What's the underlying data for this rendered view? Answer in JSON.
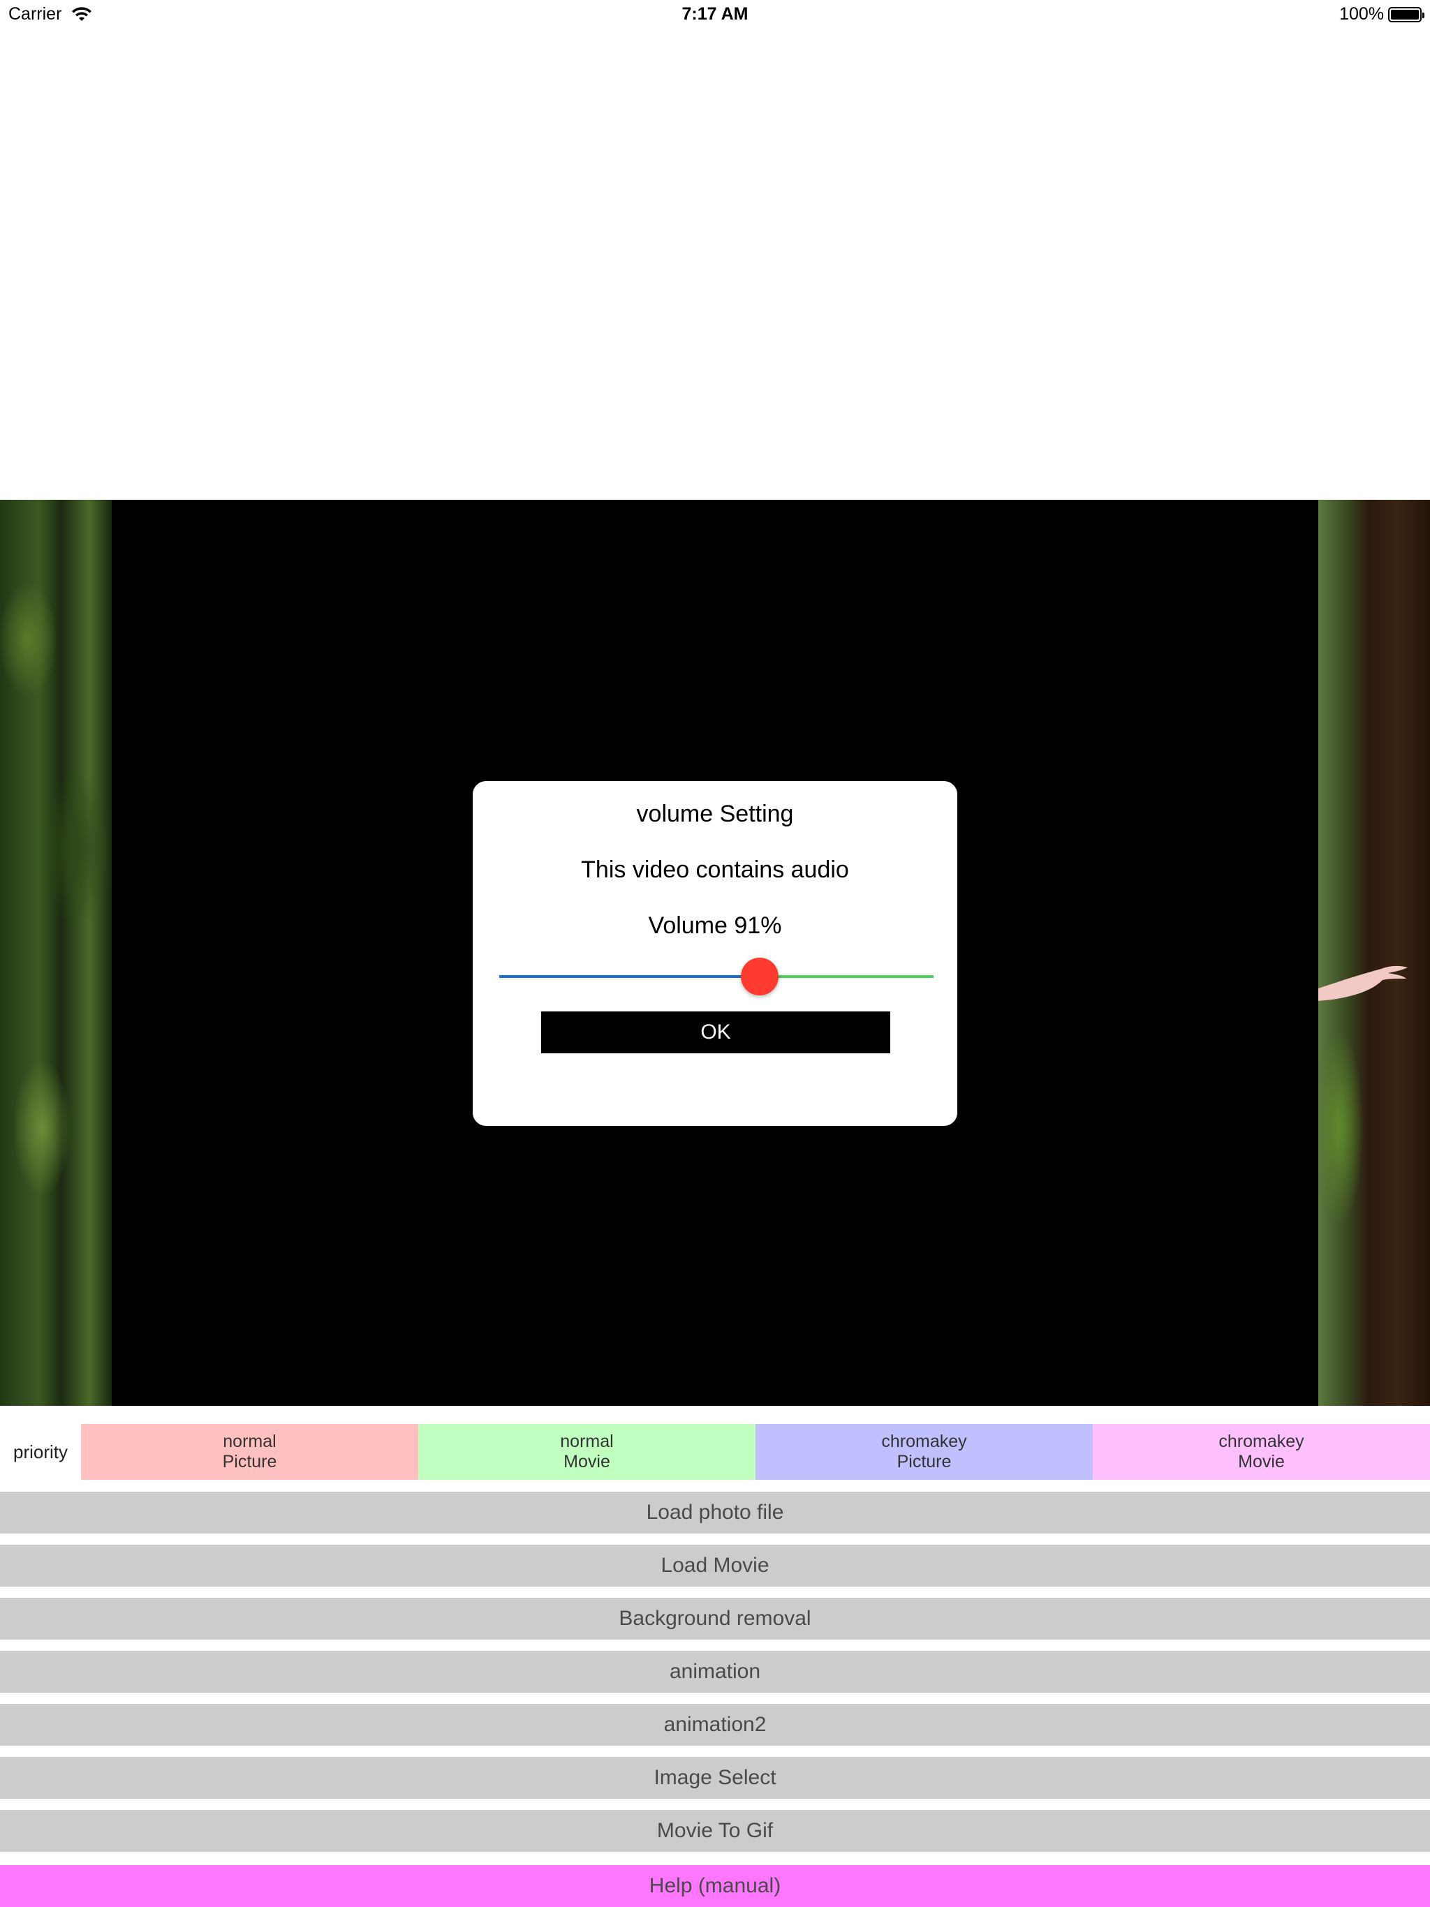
{
  "status_bar": {
    "carrier": "Carrier",
    "time": "7:17 AM",
    "battery": "100%"
  },
  "dialog": {
    "title": "volume Setting",
    "message": "This video contains audio",
    "volume_label": "Volume  91%",
    "volume_value": 0.6,
    "ok_label": "OK"
  },
  "priority": {
    "label": "priority",
    "options": [
      {
        "line1": "normal",
        "line2": "Picture",
        "color": "#ffc0c0"
      },
      {
        "line1": "normal",
        "line2": "Movie",
        "color": "#c0ffc0"
      },
      {
        "line1": "chromakey",
        "line2": "Picture",
        "color": "#c0c0ff"
      },
      {
        "line1": "chromakey",
        "line2": "Movie",
        "color": "#ffc0ff"
      }
    ]
  },
  "actions": {
    "load_photo": "Load photo file",
    "load_movie": "Load Movie",
    "background_removal": "Background removal",
    "animation": "animation",
    "animation2": "animation2",
    "image_select": "Image Select",
    "movie_to_gif": "Movie To Gif",
    "help": "Help (manual)"
  },
  "colors": {
    "action_bg": "#cccccc",
    "help_bg": "#ff77ff",
    "slider_min": "#1a6fd6",
    "slider_max": "#4cd159",
    "slider_thumb": "#ff3b30"
  }
}
